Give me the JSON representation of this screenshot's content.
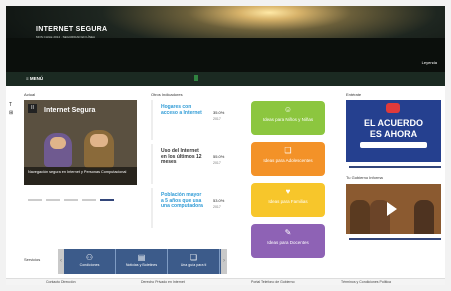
{
  "header": {
    "brand": "INTERNET SEGURA",
    "subtitle": "MOS CHILE 2014 · SEGURIDAD EN LÍNEA",
    "legend_link": "Leyenda"
  },
  "menubar": {
    "menu_label": "≡ MENÚ"
  },
  "sidetools": {
    "tool1": "T",
    "tool2": "⊞"
  },
  "sections": {
    "actual": "Actual",
    "otros": "Otros Indicadores",
    "entérate": "Entérate",
    "gobierno": "Tu Gobierno Informa",
    "servicios": "Servicios"
  },
  "slider": {
    "title": "Internet Segura",
    "caption": "Navegación segura en Internet y Personas Computacional",
    "pause": "II"
  },
  "indicators": [
    {
      "text": "Hogares con acceso a Internet",
      "value": "35.0%",
      "year": "2017",
      "color": "#2f9bd6"
    },
    {
      "text": "Uso del Internet en los últimos 12 meses",
      "value": "55.0%",
      "year": "2017",
      "color": "#333333"
    },
    {
      "text": "Población mayor a 5 años que usa una computadora",
      "value": "53.0%",
      "year": "2017",
      "color": "#2f9bd6"
    }
  ],
  "tiles": [
    {
      "label": "Ideas para Niños y Niñas",
      "icon": "☺",
      "color": "#8cc63f"
    },
    {
      "label": "Ideas para Adolescentes",
      "icon": "❑",
      "color": "#f39228"
    },
    {
      "label": "Ideas para Familias",
      "icon": "♥",
      "color": "#f7c62b"
    },
    {
      "label": "Ideas para Docentes",
      "icon": "✎",
      "color": "#8e62b5"
    }
  ],
  "poster": {
    "line1": "EL ACUERDO",
    "line2": "ES AHORA"
  },
  "services": [
    {
      "label": "Condiciones",
      "icon": "⚇"
    },
    {
      "label": "Noticias y Boletines",
      "icon": "▤"
    },
    {
      "label": "Una guía para ti",
      "icon": "❏"
    }
  ],
  "footer": {
    "c1": "Contacto Dirección",
    "c2": "Derecho Privado en Internet",
    "c3": "Portal Telefono de Gobierno",
    "c4": "Términos y Condiciones Política"
  },
  "colors": {
    "accent": "#33467a",
    "menubar": "#1b2a22",
    "services": "#3c5b8a"
  }
}
